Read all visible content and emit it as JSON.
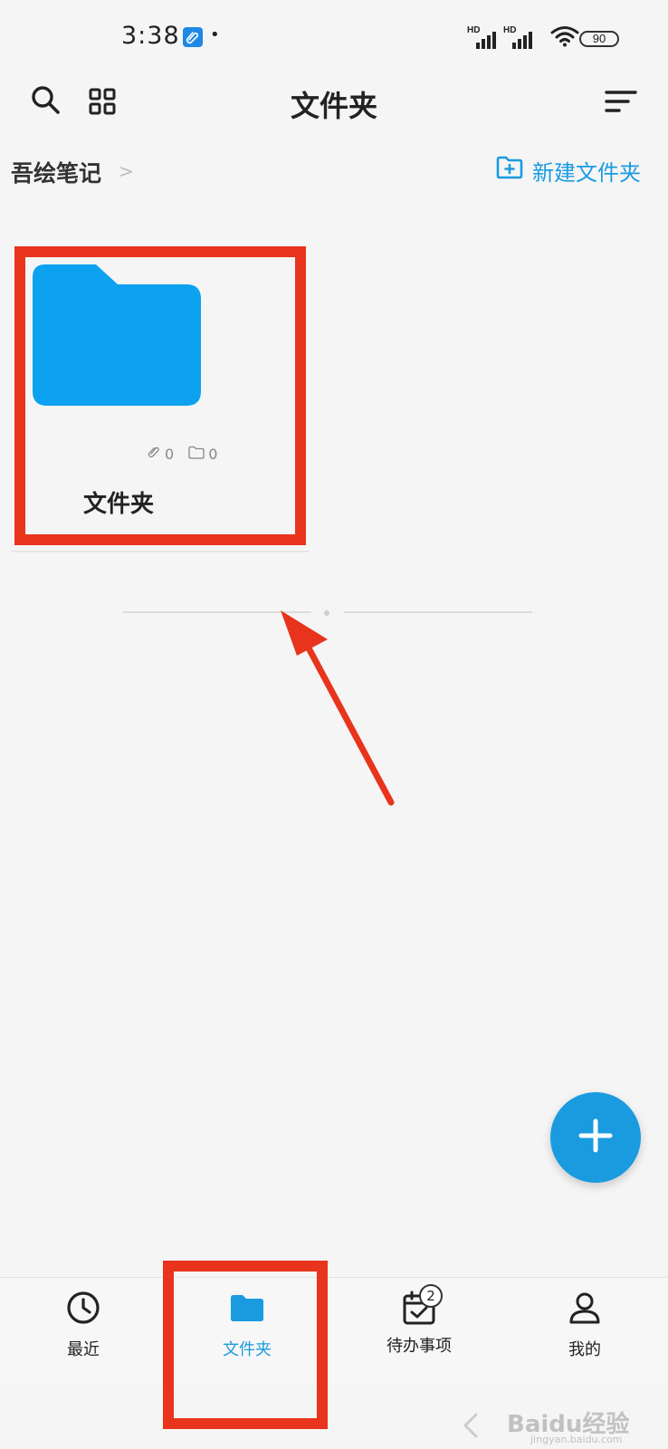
{
  "status_bar": {
    "time": "3:38",
    "dot": "•",
    "signal_1_label": "HD",
    "signal_2_label": "HD",
    "battery": "90"
  },
  "header": {
    "title": "文件夹",
    "search_icon": "search-icon",
    "grid_icon": "grid-view-icon",
    "sort_icon": "sort-icon"
  },
  "breadcrumb": {
    "root": "吾绘笔记",
    "separator": ">"
  },
  "new_folder": {
    "label": "新建文件夹",
    "icon": "folder-add-icon"
  },
  "folders": [
    {
      "name": "文件夹",
      "notes_count": "0",
      "subfolder_count": "0"
    }
  ],
  "bottom_nav": {
    "items": [
      {
        "label": "最近",
        "icon": "clock-icon"
      },
      {
        "label": "文件夹",
        "icon": "folder-icon",
        "active": true
      },
      {
        "label": "待办事项",
        "icon": "calendar-check-icon",
        "badge": "2"
      },
      {
        "label": "我的",
        "icon": "person-icon"
      }
    ]
  },
  "watermark": {
    "main": "Baidu经验",
    "sub": "jingyan.baidu.com"
  },
  "colors": {
    "accent": "#1a9be0",
    "folder": "#0da2f0",
    "highlight": "#e8341c",
    "background": "#f5f5f5"
  }
}
